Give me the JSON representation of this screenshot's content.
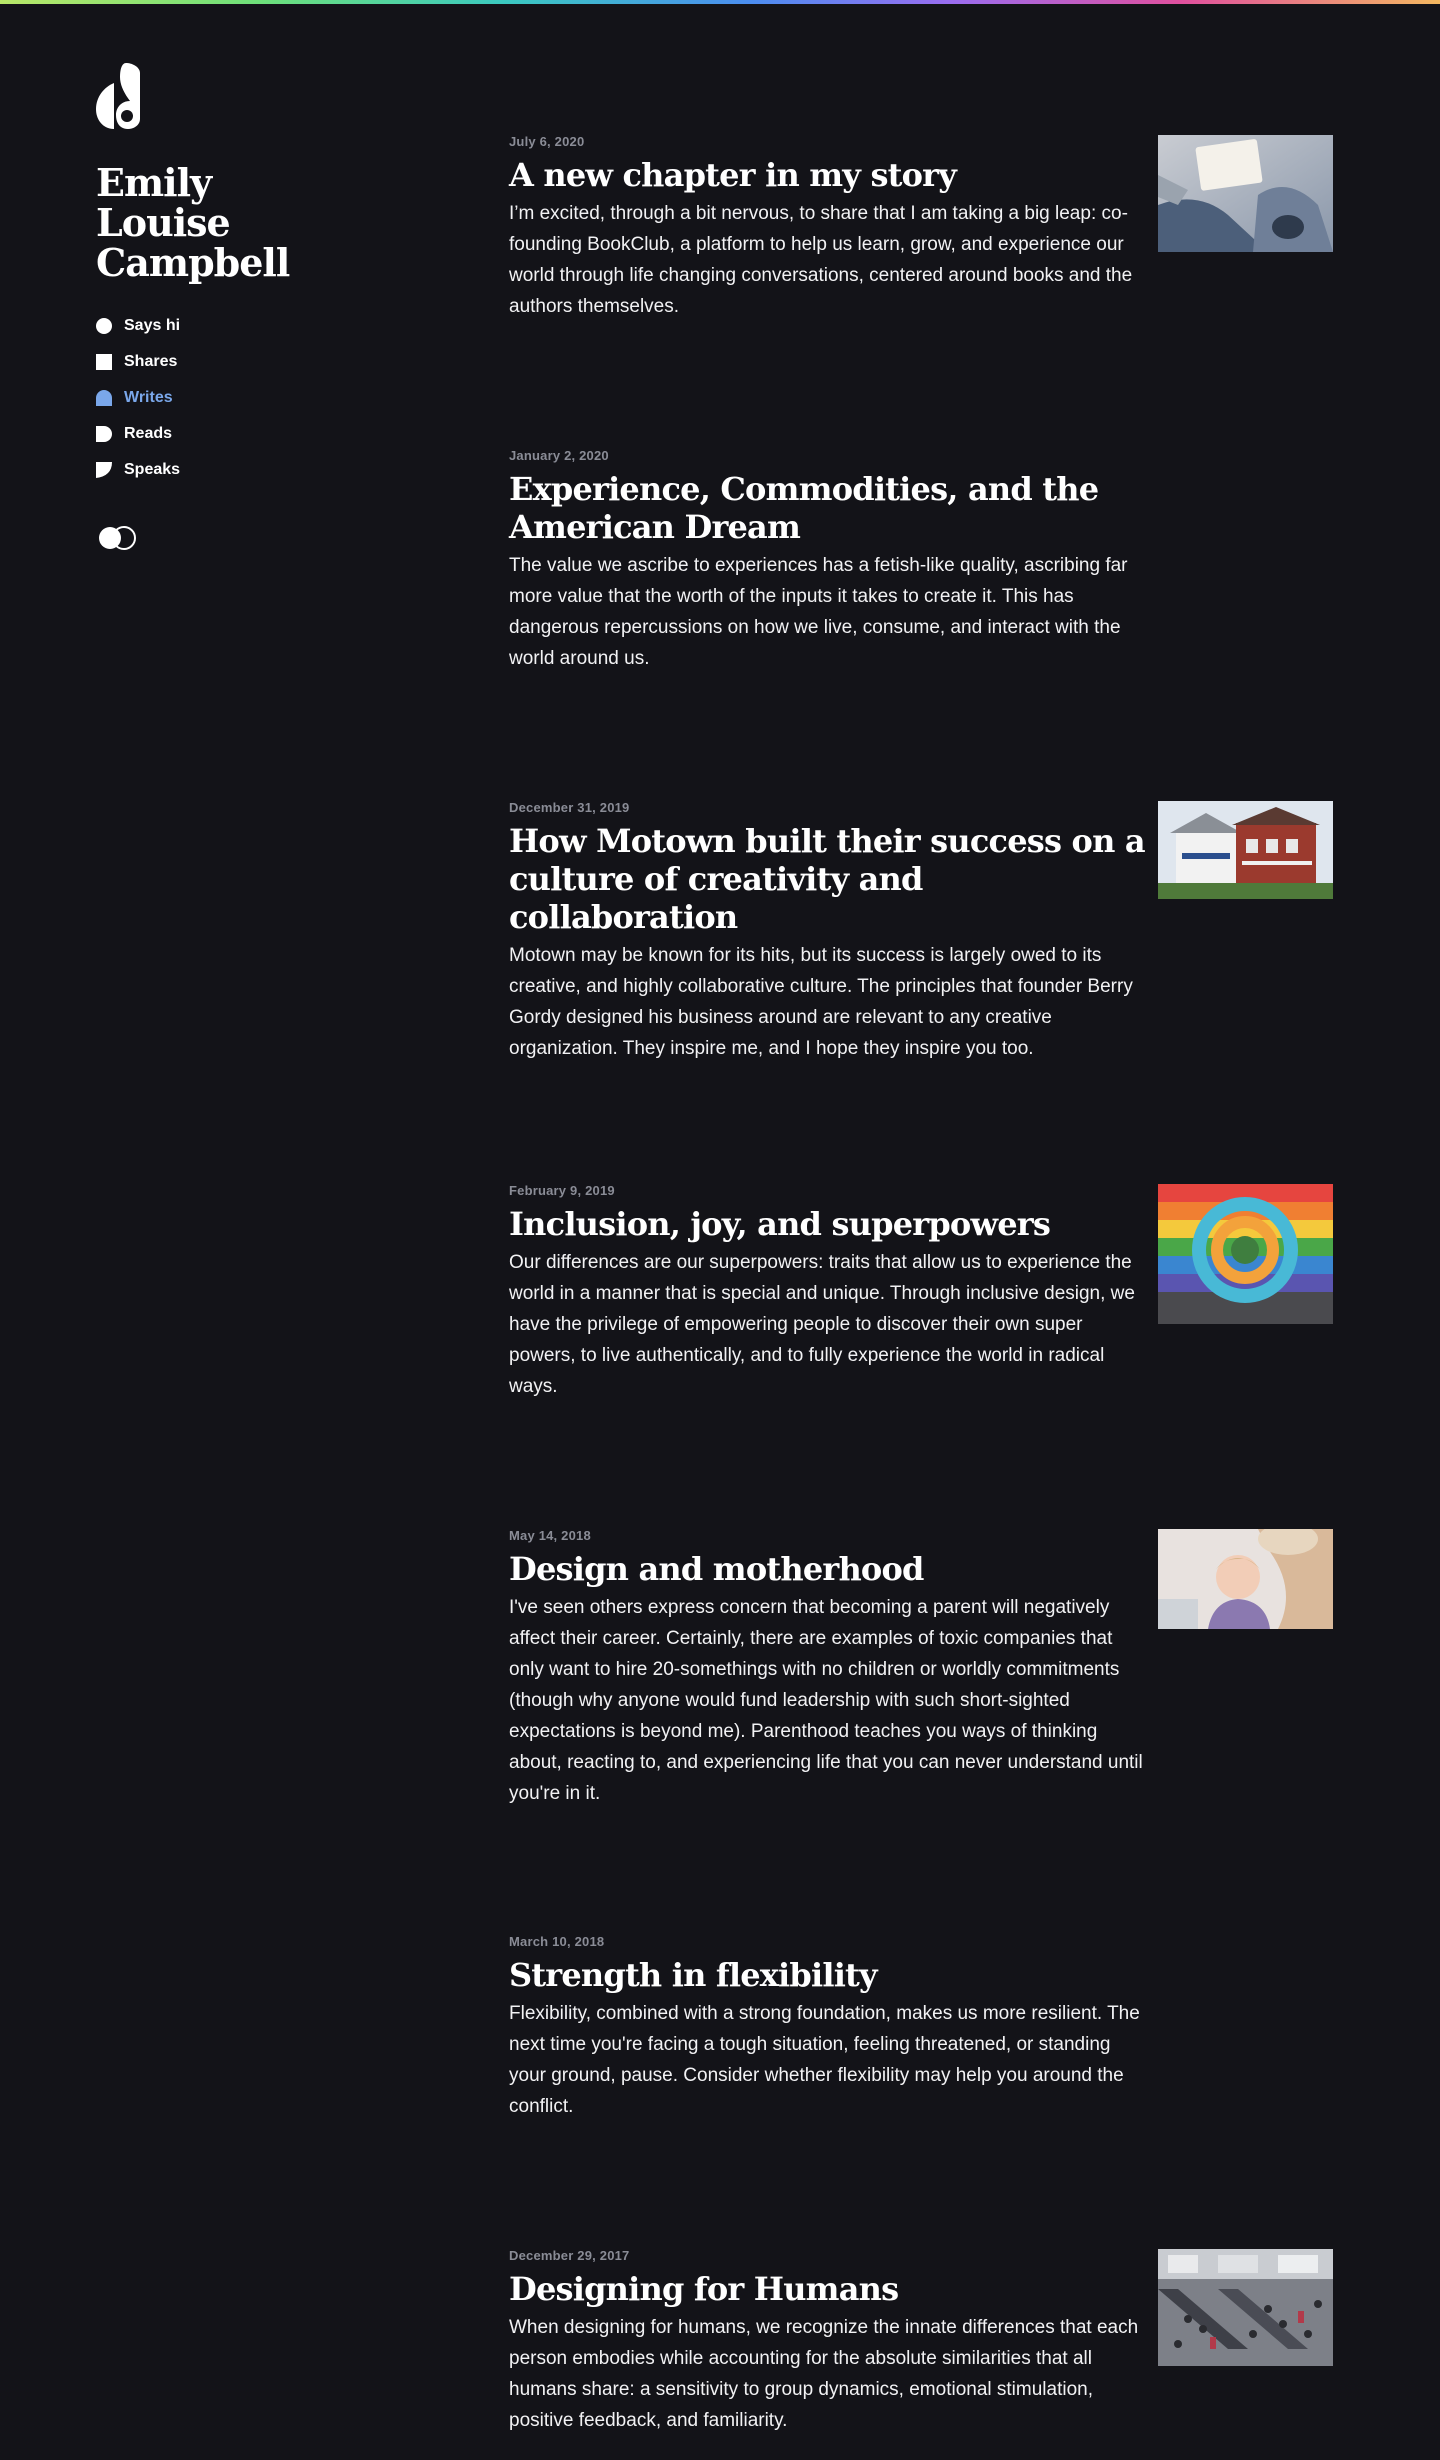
{
  "site": {
    "name": "Emily Louise Campbell",
    "logo_icon": "ec-monogram-logo-icon"
  },
  "nav": {
    "items": [
      {
        "label": "Says hi",
        "icon": "circle-icon",
        "active": false
      },
      {
        "label": "Shares",
        "icon": "square-icon",
        "active": false
      },
      {
        "label": "Writes",
        "icon": "arch-icon",
        "active": true
      },
      {
        "label": "Reads",
        "icon": "half-round-icon",
        "active": false
      },
      {
        "label": "Speaks",
        "icon": "leaf-icon",
        "active": false
      }
    ],
    "active_color": "#7aa7ea",
    "theme_toggle_icon": "theme-toggle-icon"
  },
  "colors": {
    "background": "#131318",
    "text": "#ffffff",
    "muted": "#8a8c96",
    "accent": "#7aa7ea"
  },
  "posts": [
    {
      "date": "July 6, 2020",
      "title": "A new chapter in my story",
      "excerpt": "I’m excited, through a bit nervous, to share that I am taking a big leap: co-founding BookClub, a platform to help us learn, grow, and experience our world through life changing conversations, centered around books and the authors themselves.",
      "image": "person-reading-book-photo"
    },
    {
      "date": "January 2, 2020",
      "title": "Experience, Commodities, and the American Dream",
      "excerpt": "The value we ascribe to experiences has a fetish-like quality, ascribing far more value that the worth of the inputs it takes to create it. This has dangerous repercussions on how we live, consume, and interact with the world around us.",
      "image": null
    },
    {
      "date": "December 31, 2019",
      "title": "How Motown built their success on a culture of creativity and collaboration",
      "excerpt": "Motown may be known for its hits, but its success is largely owed to its creative, and highly collaborative culture. The principles that founder Berry Gordy designed his business around are relevant to any creative organization. They inspire me, and I hope they inspire you too.",
      "image": "motown-house-photo"
    },
    {
      "date": "February 9, 2019",
      "title": "Inclusion, joy, and superpowers",
      "excerpt": "Our differences are our superpowers: traits that allow us to experience the world in a manner that is special and unique. Through inclusive design, we have the privilege of empowering people to discover their own super powers, to live authentically, and to fully experience the world in radical ways.",
      "image": "rainbow-mural-photo"
    },
    {
      "date": "May 14, 2018",
      "title": "Design and motherhood",
      "excerpt": "I've seen others express concern that becoming a parent will negatively affect their career. Certainly, there are examples of toxic companies that only want to hire 20-somethings with no children or worldly commitments (though why anyone would fund leadership with such short-sighted expectations is beyond me). Parenthood teaches you ways of thinking about, reacting to, and experiencing life that you can never understand until you're in it.",
      "image": "mother-and-child-photo"
    },
    {
      "date": "March 10, 2018",
      "title": "Strength in flexibility",
      "excerpt": "Flexibility, combined with a strong foundation, makes us more resilient. The next time you're facing a tough situation, feeling threatened, or standing your ground, pause. Consider whether flexibility may help you around the conflict.",
      "image": null
    },
    {
      "date": "December 29, 2017",
      "title": "Designing for Humans",
      "excerpt": "When designing for humans, we recognize the innate differences that each person embodies while accounting for the absolute similarities that all humans share: a sensitivity to group dynamics, emotional stimulation, positive feedback, and familiarity.",
      "image": "crowded-mall-escalators-photo"
    }
  ]
}
